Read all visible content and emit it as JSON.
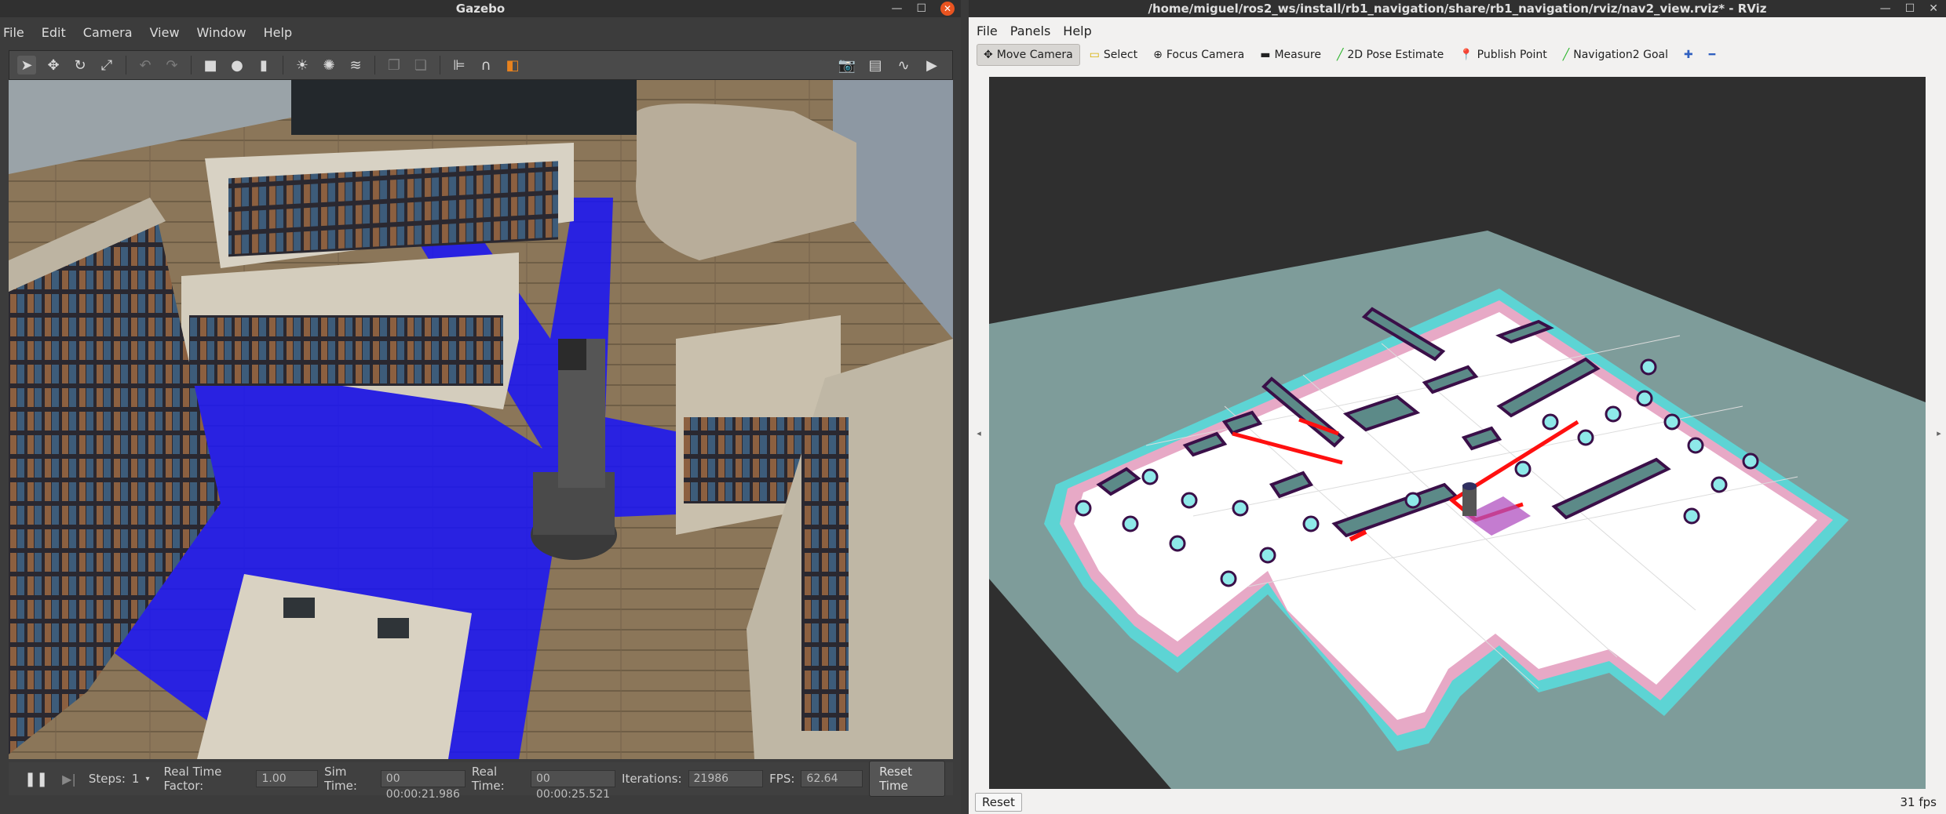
{
  "gazebo": {
    "title": "Gazebo",
    "menu": [
      "File",
      "Edit",
      "Camera",
      "View",
      "Window",
      "Help"
    ],
    "toolbar_icons": [
      "select-arrow-icon",
      "translate-icon",
      "rotate-icon",
      "scale-icon",
      "undo-icon",
      "redo-icon",
      "box-icon",
      "sphere-icon",
      "cylinder-icon",
      "point-light-icon",
      "spot-light-icon",
      "directional-light-icon",
      "copy-icon",
      "paste-icon",
      "align-icon",
      "snap-icon",
      "view-angle-icon",
      "screenshot-icon",
      "log-icon",
      "plot-icon",
      "video-icon"
    ],
    "status": {
      "steps_label": "Steps:",
      "steps_value": "1",
      "rtf_label": "Real Time Factor:",
      "rtf_value": "1.00",
      "sim_label": "Sim Time:",
      "sim_value": "00 00:00:21.986",
      "real_label": "Real Time:",
      "real_value": "00 00:00:25.521",
      "iter_label": "Iterations:",
      "iter_value": "21986",
      "fps_label": "FPS:",
      "fps_value": "62.64",
      "reset_label": "Reset Time"
    },
    "colors": {
      "laser": "#1010ff",
      "floor": "#8a7558"
    }
  },
  "rviz": {
    "title": "/home/miguel/ros2_ws/install/rb1_navigation/share/rb1_navigation/rviz/nav2_view.rviz* - RViz",
    "menu": [
      "File",
      "Panels",
      "Help"
    ],
    "tools": [
      {
        "label": "Move Camera",
        "icon": "move-camera-icon"
      },
      {
        "label": "Select",
        "icon": "select-icon"
      },
      {
        "label": "Focus Camera",
        "icon": "focus-camera-icon"
      },
      {
        "label": "Measure",
        "icon": "measure-icon"
      },
      {
        "label": "2D Pose Estimate",
        "icon": "pose-estimate-icon"
      },
      {
        "label": "Publish Point",
        "icon": "publish-point-icon"
      },
      {
        "label": "Navigation2 Goal",
        "icon": "nav-goal-icon"
      }
    ],
    "reset_label": "Reset",
    "fps": "31 fps",
    "colors": {
      "map_bg": "#7e9c9a",
      "costmap_cyan": "#6ee8e8",
      "inflation_pink": "#e8a8c8",
      "path_red": "#ff1010"
    }
  }
}
